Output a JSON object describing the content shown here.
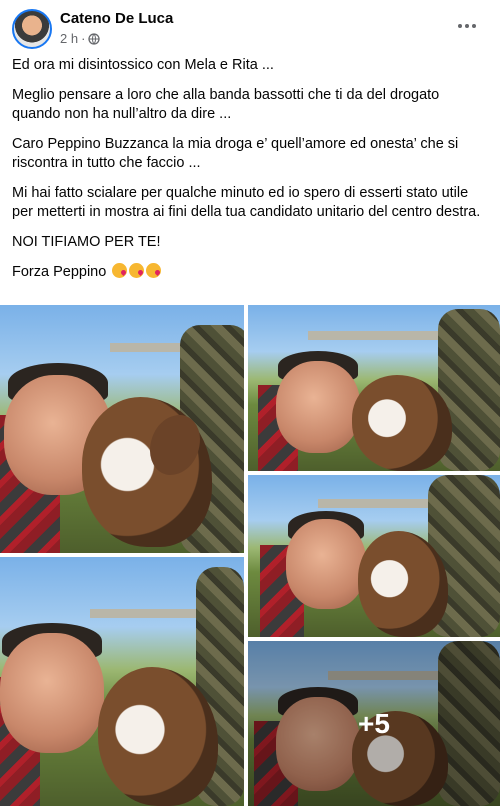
{
  "post": {
    "author": "Cateno De Luca",
    "time": "2 h",
    "separator": "·",
    "privacy_icon": "globe-icon",
    "more_icon": "more-horizontal-icon"
  },
  "text": {
    "p1": "Ed ora mi disintossico con Mela e Rita ...",
    "p2": "Meglio pensare a loro che alla banda bassotti che ti da del drogato quando non ha null’altro da dire ...",
    "p3": "Caro Peppino Buzzanca la mia droga e’ quell’amore  ed onesta’  che si riscontra in tutto che faccio ...",
    "p4": "Mi hai fatto scialare per qualche minuto ed io spero di esserti stato utile per metterti in mostra ai fini della tua candidato unitario del centro destra.",
    "p5": "NOI TIFIAMO PER TE!",
    "p6": "Forza Peppino",
    "p6_emojis": [
      "kiss-emoji",
      "kiss-emoji",
      "kiss-emoji"
    ]
  },
  "gallery": {
    "photos": [
      {
        "description": "photo-1"
      },
      {
        "description": "photo-2"
      },
      {
        "description": "photo-3"
      },
      {
        "description": "photo-4"
      },
      {
        "description": "photo-5"
      },
      {
        "description": "photo-6"
      }
    ],
    "more_count": "+5"
  },
  "colors": {
    "accent": "#1877f2",
    "secondary_text": "#65676b",
    "primary_text": "#050505"
  }
}
